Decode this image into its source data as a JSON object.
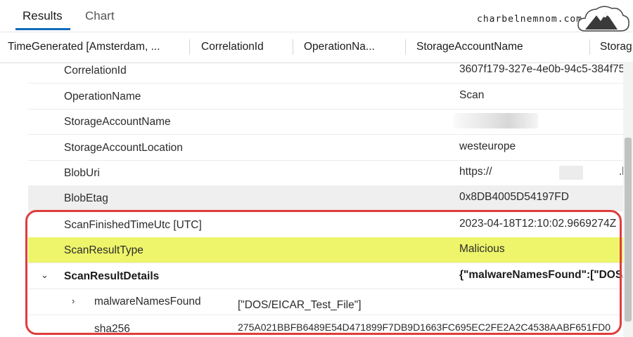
{
  "tabs": [
    {
      "label": "Results",
      "active": true
    },
    {
      "label": "Chart",
      "active": false
    }
  ],
  "watermark": "charbelnemnom.com",
  "columns": [
    "TimeGenerated [Amsterdam, ...",
    "CorrelationId",
    "OperationNa...",
    "StorageAccountName",
    "Storag"
  ],
  "rows": [
    {
      "key": "CorrelationId",
      "value": "3607f179-327e-4e0b-94c5-384f75"
    },
    {
      "key": "OperationName",
      "value": "Scan"
    },
    {
      "key": "StorageAccountName",
      "value": ""
    },
    {
      "key": "StorageAccountLocation",
      "value": "westeurope"
    },
    {
      "key": "BlobUri",
      "value": "https://",
      "value_tail": ".b"
    },
    {
      "key": "BlobEtag",
      "value": "0x8DB4005D54197FD"
    },
    {
      "key": "ScanFinishedTimeUtc [UTC]",
      "value": "2023-04-18T12:10:02.9669274Z"
    },
    {
      "key": "ScanResultType",
      "value": "Malicious"
    },
    {
      "key": "ScanResultDetails",
      "value": "{\"malwareNamesFound\":[\"DOS/E"
    }
  ],
  "nested": [
    {
      "key": "malwareNamesFound",
      "value": "[\"DOS/EICAR_Test_File\"]"
    },
    {
      "key": "sha256",
      "value": "275A021BBFB6489E54D471899F7DB9D1663FC695EC2FE2A2C4538AABF651FD0"
    }
  ],
  "colors": {
    "accent": "#0f6cbd",
    "highlight_row": "#eef56a",
    "annotation_border": "#e03c3c"
  },
  "icons": {
    "expand_open": "chevron-down-icon",
    "expand_closed": "chevron-right-icon"
  }
}
